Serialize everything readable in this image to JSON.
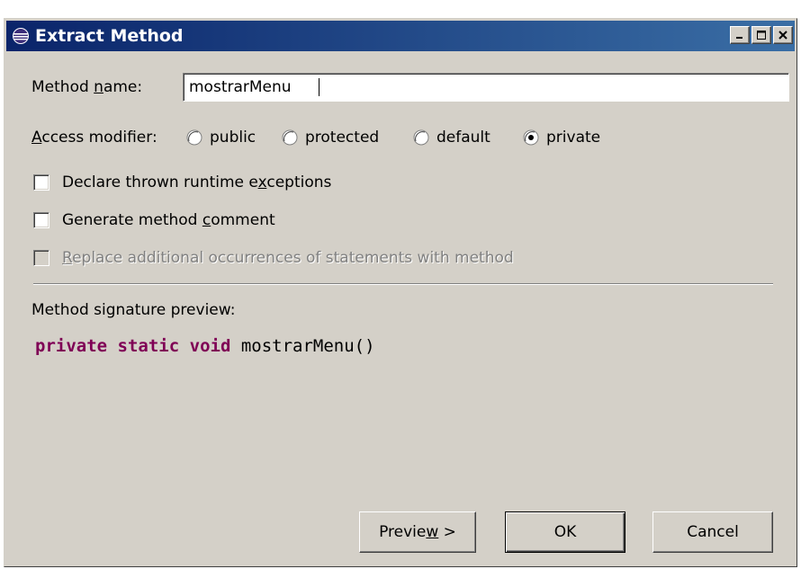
{
  "window": {
    "title": "Extract Method",
    "controls": {
      "minimize": "minimize",
      "maximize": "maximize",
      "close": "close"
    }
  },
  "method_name": {
    "label_before": "Method ",
    "label_mnemonic": "n",
    "label_after": "ame:",
    "value": "mostrarMenu"
  },
  "access_modifier": {
    "label_mnemonic": "A",
    "label_after": "ccess modifier:",
    "options": [
      {
        "label": "public",
        "selected": false
      },
      {
        "label": "protected",
        "selected": false
      },
      {
        "label": "default",
        "selected": false
      },
      {
        "label": "private",
        "selected": true
      }
    ]
  },
  "options": {
    "declare_exceptions": {
      "before": "Declare thrown runtime e",
      "mnemonic": "x",
      "after": "ceptions",
      "checked": false,
      "enabled": true
    },
    "generate_comment": {
      "before": "Generate method ",
      "mnemonic": "c",
      "after": "omment",
      "checked": false,
      "enabled": true
    },
    "replace_occurrences": {
      "before": "",
      "mnemonic": "R",
      "after": "eplace additional occurrences of statements with method",
      "checked": false,
      "enabled": false
    }
  },
  "preview": {
    "label": "Method signature preview:",
    "kw1": "private",
    "kw2": "static",
    "kw3": "void",
    "signature": "mostrarMenu()"
  },
  "buttons": {
    "preview_before": "Previe",
    "preview_mnemonic": "w",
    "preview_after": " >",
    "ok": "OK",
    "cancel": "Cancel"
  },
  "colors": {
    "title_bar_start": "#0a246a",
    "title_bar_end": "#3a6ea5",
    "dialog_bg": "#d4d0c8",
    "keyword": "#7f0055"
  }
}
